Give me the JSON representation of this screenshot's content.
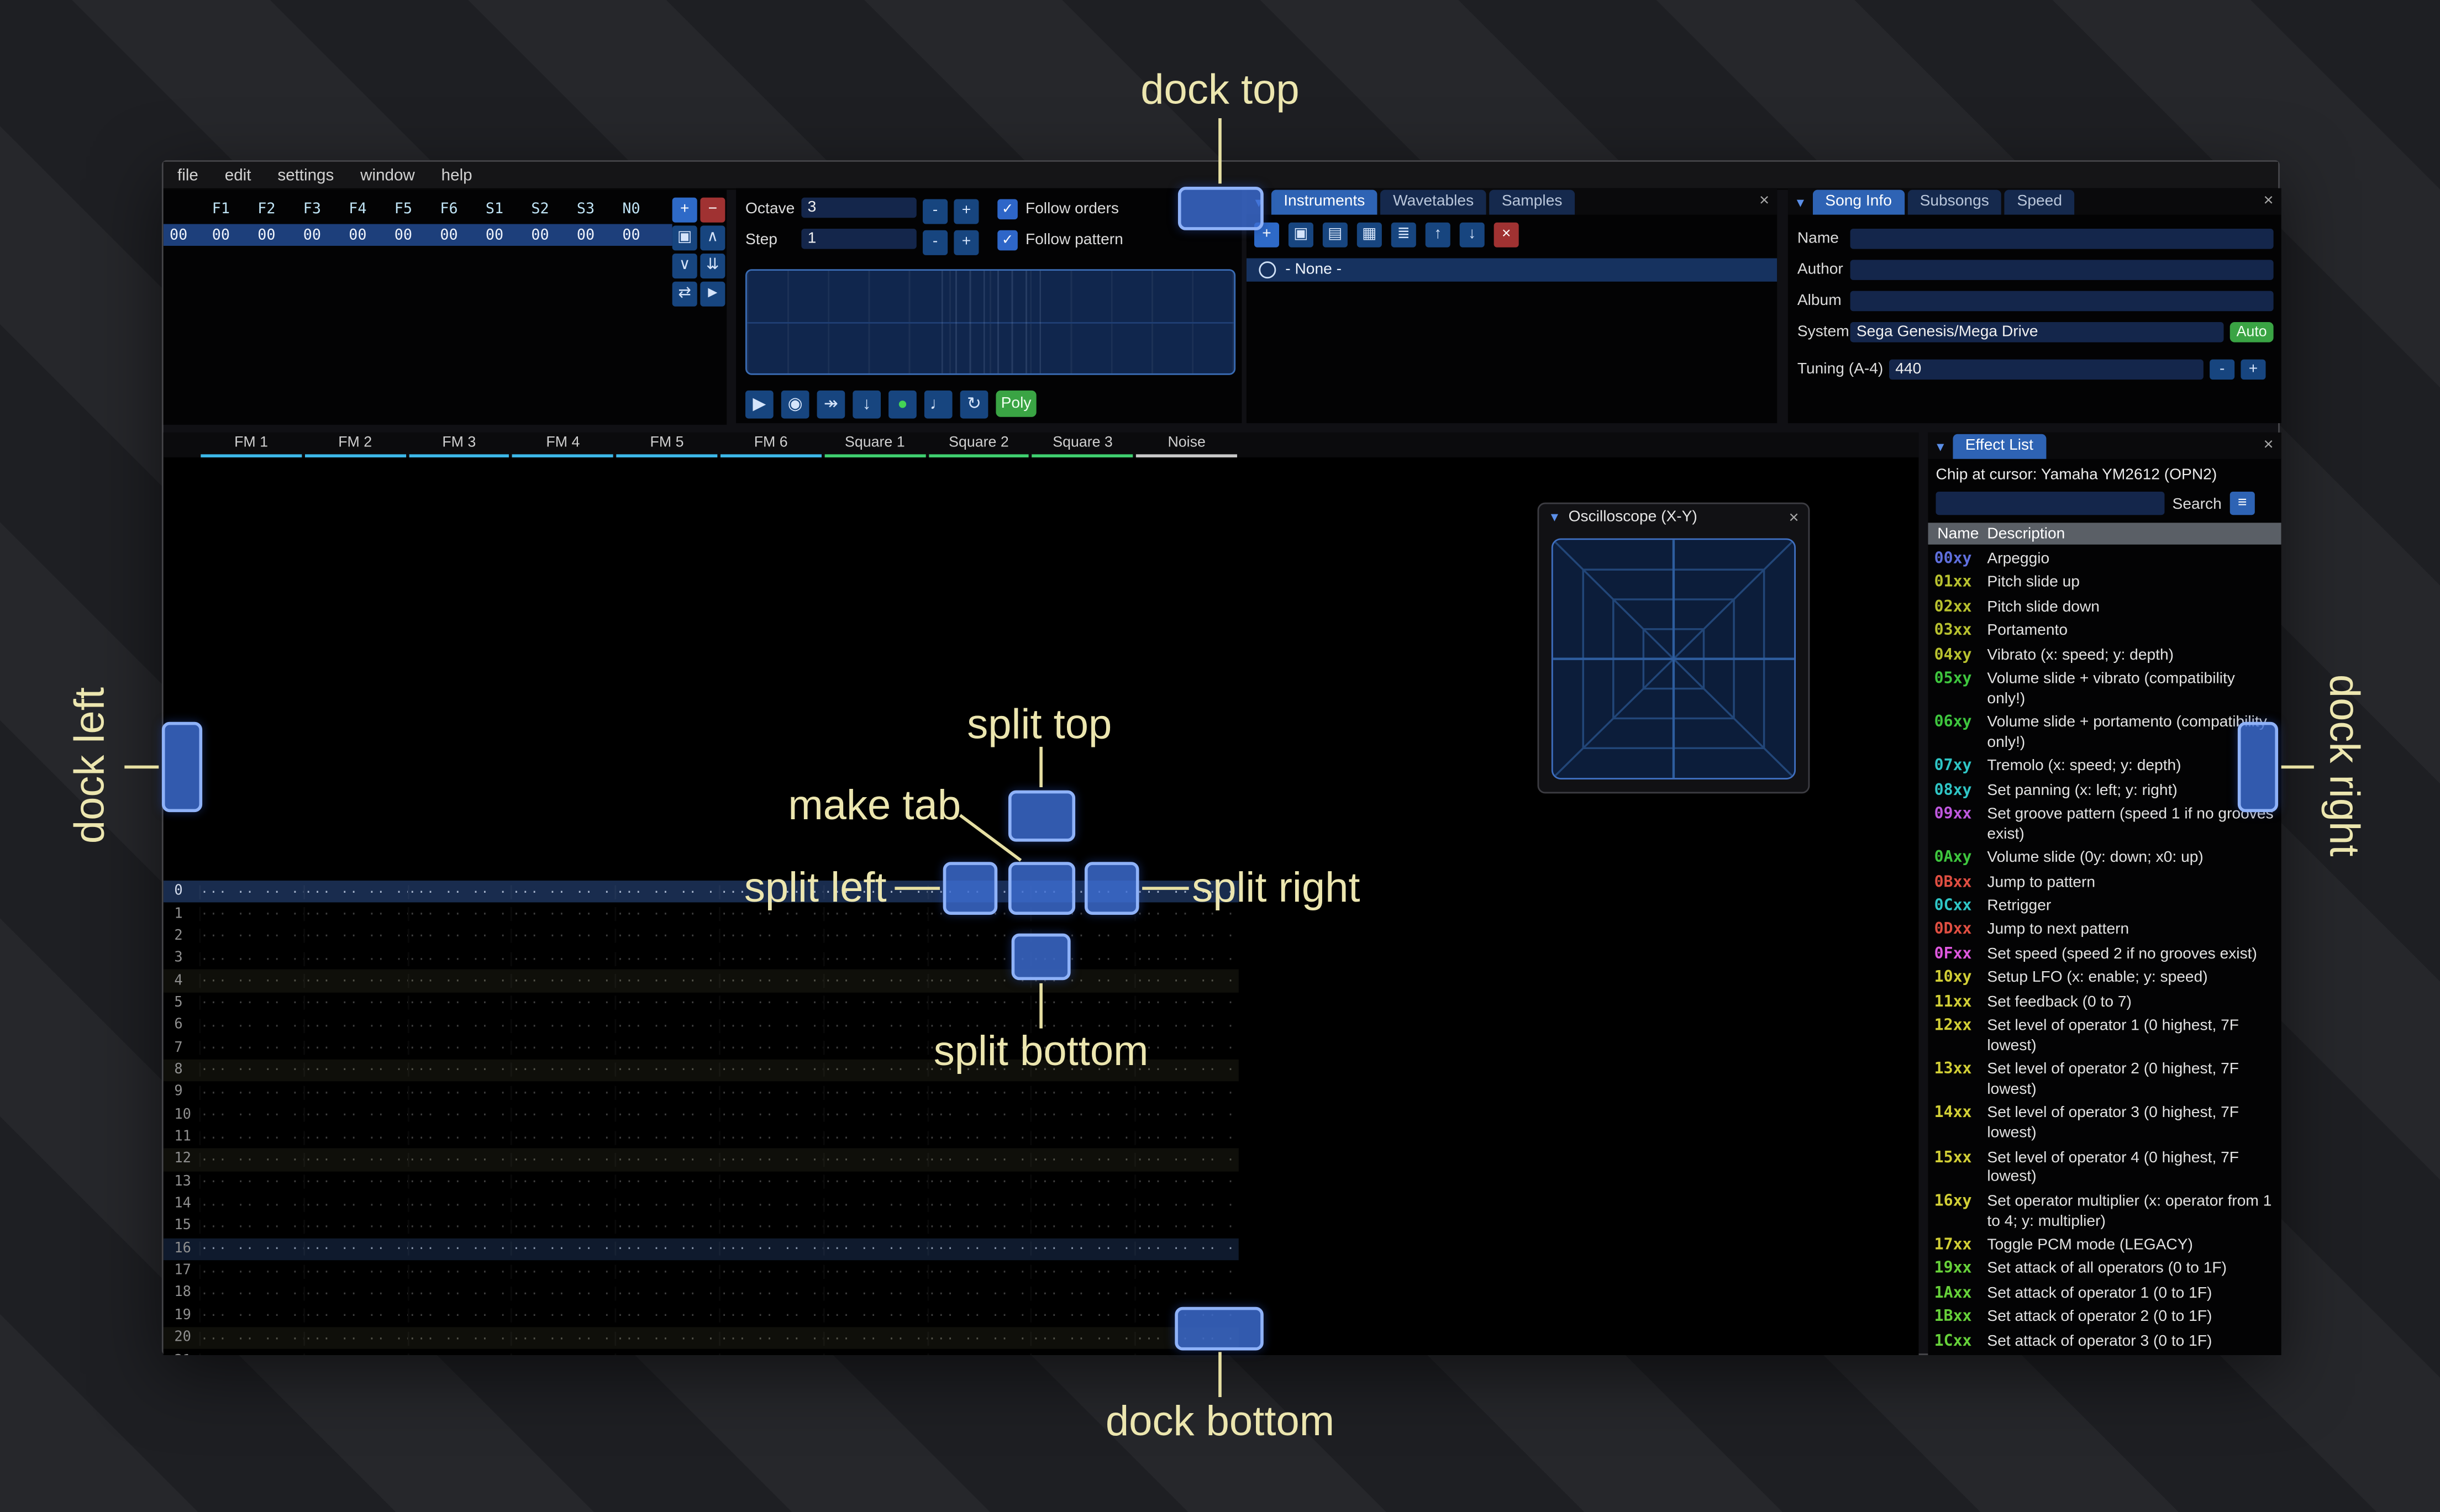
{
  "icons": {
    "close": "×",
    "collapse": "▼",
    "check": "✓",
    "menu": "≡"
  },
  "menu": {
    "items": [
      "file",
      "edit",
      "settings",
      "window",
      "help"
    ]
  },
  "orders": {
    "header": [
      "F1",
      "F2",
      "F3",
      "F4",
      "F5",
      "F6",
      "S1",
      "S2",
      "S3",
      "N0"
    ],
    "rows": [
      {
        "index": "00",
        "values": [
          "00",
          "00",
          "00",
          "00",
          "00",
          "00",
          "00",
          "00",
          "00",
          "00"
        ]
      }
    ],
    "buttons": [
      {
        "name": "order-add-button",
        "icon": "plus-icon",
        "glyph": "+",
        "style": "add"
      },
      {
        "name": "order-remove-button",
        "icon": "minus-icon",
        "glyph": "−",
        "style": "remove"
      },
      {
        "name": "order-duplicate-button",
        "icon": "duplicate-icon",
        "glyph": "▣",
        "style": ""
      },
      {
        "name": "order-move-up-button",
        "icon": "chevron-up-icon",
        "glyph": "∧",
        "style": ""
      },
      {
        "name": "order-move-down-button",
        "icon": "chevron-down-icon",
        "glyph": "∨",
        "style": ""
      },
      {
        "name": "order-deep-clone-button",
        "icon": "double-down-arrow-icon",
        "glyph": "⇊",
        "style": ""
      },
      {
        "name": "order-change-mode-button",
        "icon": "swap-icon",
        "glyph": "⇄",
        "style": ""
      },
      {
        "name": "order-edit-button",
        "icon": "cursor-icon",
        "glyph": "►",
        "style": ""
      }
    ]
  },
  "controls": {
    "octave_label": "Octave",
    "octave_value": "3",
    "step_label": "Step",
    "step_value": "1",
    "minus_label": "-",
    "plus_label": "+",
    "follow_orders_label": "Follow orders",
    "follow_pattern_label": "Follow pattern",
    "poly_label": "Poly",
    "transport": [
      {
        "name": "play-button",
        "icon": "play-icon",
        "glyph": "▶",
        "style": ""
      },
      {
        "name": "play-pattern-button",
        "icon": "play-circle-icon",
        "glyph": "◉",
        "style": ""
      },
      {
        "name": "step-row-button",
        "icon": "step-forward-icon",
        "glyph": "↠",
        "style": ""
      },
      {
        "name": "move-cursor-down-button",
        "icon": "arrow-down-icon",
        "glyph": "↓",
        "style": ""
      },
      {
        "name": "edit-toggle-button",
        "icon": "record-dot-icon",
        "glyph": "●",
        "style": "green-dot"
      },
      {
        "name": "metronome-button",
        "icon": "metronome-icon",
        "glyph": "♩",
        "style": ""
      },
      {
        "name": "repeat-pattern-button",
        "icon": "repeat-icon",
        "glyph": "↻",
        "style": ""
      }
    ]
  },
  "instruments": {
    "tabs": [
      {
        "label": "Instruments",
        "active": true
      },
      {
        "label": "Wavetables",
        "active": false
      },
      {
        "label": "Samples",
        "active": false
      }
    ],
    "toolbar": [
      {
        "name": "instrument-add-button",
        "icon": "plus-icon",
        "glyph": "+",
        "style": "add"
      },
      {
        "name": "instrument-clone-button",
        "icon": "clone-icon",
        "glyph": "▣",
        "style": ""
      },
      {
        "name": "instrument-open-button",
        "icon": "folder-open-icon",
        "glyph": "▤",
        "style": ""
      },
      {
        "name": "instrument-save-button",
        "icon": "save-icon",
        "glyph": "▦",
        "style": ""
      },
      {
        "name": "instrument-folders-button",
        "icon": "list-tree-icon",
        "glyph": "≣",
        "style": ""
      },
      {
        "name": "instrument-move-up-button",
        "icon": "arrow-up-icon",
        "glyph": "↑",
        "style": ""
      },
      {
        "name": "instrument-move-down-button",
        "icon": "arrow-down-icon",
        "glyph": "↓",
        "style": ""
      },
      {
        "name": "instrument-delete-button",
        "icon": "delete-x-icon",
        "glyph": "×",
        "style": "remove"
      }
    ],
    "list": [
      {
        "label": "- None -",
        "selected": true
      }
    ]
  },
  "song_info": {
    "tabs": [
      {
        "label": "Song Info",
        "active": true
      },
      {
        "label": "Subsongs",
        "active": false
      },
      {
        "label": "Speed",
        "active": false
      }
    ],
    "fields": [
      {
        "label": "Name",
        "value": ""
      },
      {
        "label": "Author",
        "value": ""
      },
      {
        "label": "Album",
        "value": ""
      }
    ],
    "system_label": "System",
    "system_value": "Sega Genesis/Mega Drive",
    "auto_label": "Auto",
    "tuning_label": "Tuning (A-4)",
    "tuning_value": "440"
  },
  "pattern": {
    "corner_label": "++",
    "row_count": 22,
    "empty_cell": "··· ·· ·· ···",
    "channels": [
      {
        "name": "FM 1",
        "color": "#3db8e8"
      },
      {
        "name": "FM 2",
        "color": "#3db8e8"
      },
      {
        "name": "FM 3",
        "color": "#3db8e8"
      },
      {
        "name": "FM 4",
        "color": "#3db8e8"
      },
      {
        "name": "FM 5",
        "color": "#3db8e8"
      },
      {
        "name": "FM 6",
        "color": "#3db8e8"
      },
      {
        "name": "Square 1",
        "color": "#3fcf6f"
      },
      {
        "name": "Square 2",
        "color": "#3fcf6f"
      },
      {
        "name": "Square 3",
        "color": "#3fcf6f"
      },
      {
        "name": "Noise",
        "color": "#c8c8c8"
      }
    ]
  },
  "oscilloscope": {
    "title": "Oscilloscope (X-Y)"
  },
  "effect_list": {
    "tab_label": "Effect List",
    "chip_label": "Chip at cursor: Yamaha YM2612 (OPN2)",
    "search_label": "Search",
    "search_value": "",
    "columns": {
      "name": "Name",
      "description": "Description"
    },
    "effects": [
      {
        "code": "00xy",
        "color": "#5f6fdd",
        "desc": "Arpeggio"
      },
      {
        "code": "01xx",
        "color": "#b9c22f",
        "desc": "Pitch slide up"
      },
      {
        "code": "02xx",
        "color": "#b9c22f",
        "desc": "Pitch slide down"
      },
      {
        "code": "03xx",
        "color": "#b9c22f",
        "desc": "Portamento"
      },
      {
        "code": "04xy",
        "color": "#b9c22f",
        "desc": "Vibrato (x: speed; y: depth)"
      },
      {
        "code": "05xy",
        "color": "#3ec63e",
        "desc": "Volume slide + vibrato (compatibility only!)"
      },
      {
        "code": "06xy",
        "color": "#3ec63e",
        "desc": "Volume slide + portamento (compatibility only!)"
      },
      {
        "code": "07xy",
        "color": "#2fc6c6",
        "desc": "Tremolo (x: speed; y: depth)"
      },
      {
        "code": "08xy",
        "color": "#2fc6c6",
        "desc": "Set panning (x: left; y: right)"
      },
      {
        "code": "09xx",
        "color": "#bf58df",
        "desc": "Set groove pattern (speed 1 if no grooves exist)"
      },
      {
        "code": "0Axy",
        "color": "#3ec63e",
        "desc": "Volume slide (0y: down; x0: up)"
      },
      {
        "code": "0Bxx",
        "color": "#e14f42",
        "desc": "Jump to pattern"
      },
      {
        "code": "0Cxx",
        "color": "#2fc6c6",
        "desc": "Retrigger"
      },
      {
        "code": "0Dxx",
        "color": "#e14f42",
        "desc": "Jump to next pattern"
      },
      {
        "code": "0Fxx",
        "color": "#df58df",
        "desc": "Set speed (speed 2 if no grooves exist)"
      },
      {
        "code": "10xy",
        "color": "#d2cf36",
        "desc": "Setup LFO (x: enable; y: speed)"
      },
      {
        "code": "11xx",
        "color": "#d2cf36",
        "desc": "Set feedback (0 to 7)"
      },
      {
        "code": "12xx",
        "color": "#d2cf36",
        "desc": "Set level of operator 1 (0 highest, 7F lowest)"
      },
      {
        "code": "13xx",
        "color": "#d2cf36",
        "desc": "Set level of operator 2 (0 highest, 7F lowest)"
      },
      {
        "code": "14xx",
        "color": "#d2cf36",
        "desc": "Set level of operator 3 (0 highest, 7F lowest)"
      },
      {
        "code": "15xx",
        "color": "#d2cf36",
        "desc": "Set level of operator 4 (0 highest, 7F lowest)"
      },
      {
        "code": "16xy",
        "color": "#d2cf36",
        "desc": "Set operator multiplier (x: operator from 1 to 4; y: multiplier)"
      },
      {
        "code": "17xx",
        "color": "#d2cf36",
        "desc": "Toggle PCM mode (LEGACY)"
      },
      {
        "code": "19xx",
        "color": "#67d23a",
        "desc": "Set attack of all operators (0 to 1F)"
      },
      {
        "code": "1Axx",
        "color": "#67d23a",
        "desc": "Set attack of operator 1 (0 to 1F)"
      },
      {
        "code": "1Bxx",
        "color": "#67d23a",
        "desc": "Set attack of operator 2 (0 to 1F)"
      },
      {
        "code": "1Cxx",
        "color": "#67d23a",
        "desc": "Set attack of operator 3 (0 to 1F)"
      }
    ]
  },
  "overlays": {
    "dock_top": "dock top",
    "dock_left": "dock left",
    "dock_right": "dock right",
    "dock_bottom": "dock bottom",
    "split_top": "split top",
    "split_left": "split left",
    "split_right": "split right",
    "split_bottom": "split bottom",
    "make_tab": "make tab"
  }
}
